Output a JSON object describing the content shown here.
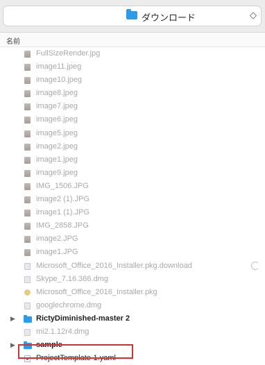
{
  "toolbar": {
    "location_label": "ダウンロード",
    "stepper_glyph": "◇"
  },
  "columns": {
    "name_header": "名前"
  },
  "files": [
    {
      "name": "FullSizeRender.jpg",
      "icon": "image-icon",
      "enabled": false
    },
    {
      "name": "image11.jpeg",
      "icon": "image-icon",
      "enabled": false
    },
    {
      "name": "image10.jpeg",
      "icon": "image-icon",
      "enabled": false
    },
    {
      "name": "image8.jpeg",
      "icon": "image-icon",
      "enabled": false
    },
    {
      "name": "image7.jpeg",
      "icon": "image-icon",
      "enabled": false
    },
    {
      "name": "image6.jpeg",
      "icon": "image-icon",
      "enabled": false
    },
    {
      "name": "image5.jpeg",
      "icon": "image-icon",
      "enabled": false
    },
    {
      "name": "image2.jpeg",
      "icon": "image-icon",
      "enabled": false
    },
    {
      "name": "image1.jpeg",
      "icon": "image-icon",
      "enabled": false
    },
    {
      "name": "image9.jpeg",
      "icon": "image-icon",
      "enabled": false
    },
    {
      "name": "IMG_1506.JPG",
      "icon": "image-icon",
      "enabled": false
    },
    {
      "name": "image2 (1).JPG",
      "icon": "image-icon",
      "enabled": false
    },
    {
      "name": "image1 (1).JPG",
      "icon": "image-icon",
      "enabled": false
    },
    {
      "name": "IMG_2858.JPG",
      "icon": "image-icon",
      "enabled": false
    },
    {
      "name": "image2.JPG",
      "icon": "image-icon",
      "enabled": false
    },
    {
      "name": "image1.JPG",
      "icon": "image-icon",
      "enabled": false
    },
    {
      "name": "Microsoft_Office_2016_Installer.pkg.download",
      "icon": "download-document-icon",
      "enabled": false,
      "spinner": true
    },
    {
      "name": "Skype_7.16.386.dmg",
      "icon": "disk-image-icon",
      "enabled": false
    },
    {
      "name": "Microsoft_Office_2016_Installer.pkg",
      "icon": "package-icon",
      "enabled": false
    },
    {
      "name": "googlechrome.dmg",
      "icon": "disk-image-icon",
      "enabled": false
    },
    {
      "name": "RictyDiminished-master 2",
      "icon": "folder-icon",
      "enabled": true,
      "folder": true
    },
    {
      "name": "mi2.1.12r4.dmg",
      "icon": "disk-image-icon",
      "enabled": false
    },
    {
      "name": "sample",
      "icon": "folder-icon",
      "enabled": true,
      "folder": true
    },
    {
      "name": "ProjectTemplate-1.yaml",
      "icon": "yaml-file-icon",
      "enabled": true,
      "selected": true
    }
  ],
  "colors": {
    "folder": "#2f9be8",
    "highlight": "#d62f2f"
  }
}
